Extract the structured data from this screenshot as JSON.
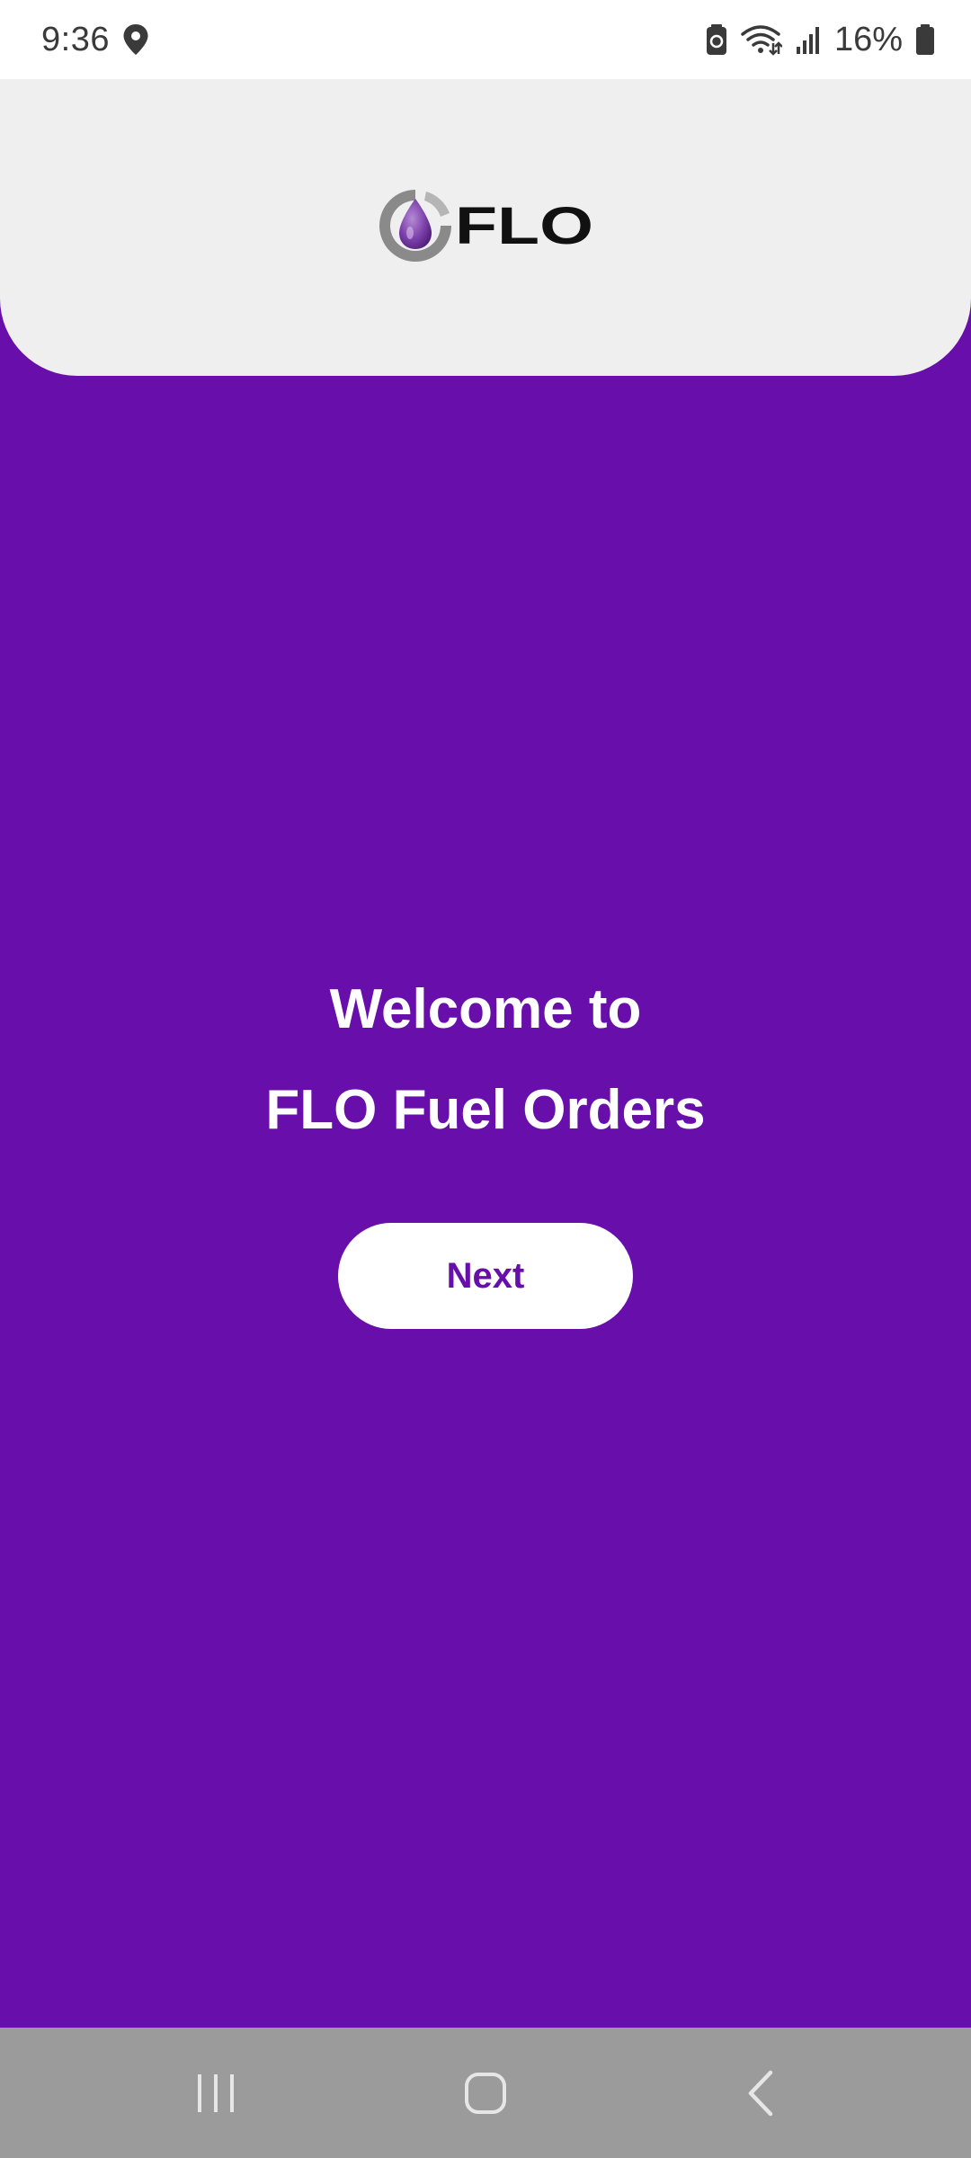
{
  "status_bar": {
    "time": "9:36",
    "battery_percent": "16%",
    "icons": [
      "location-icon",
      "battery-saver-icon",
      "wifi-icon",
      "signal-icon",
      "battery-icon"
    ]
  },
  "header": {
    "logo_text": "FLO",
    "background_color": "#efefef"
  },
  "welcome": {
    "line1": "Welcome to",
    "line2": "FLO Fuel Orders",
    "next_label": "Next"
  },
  "nav_bar": {
    "icons": [
      "recents-icon",
      "home-icon",
      "back-icon"
    ]
  },
  "colors": {
    "brand_purple": "#670eab",
    "nav_bar": "#9b9b9b",
    "text_white": "#ffffff"
  }
}
